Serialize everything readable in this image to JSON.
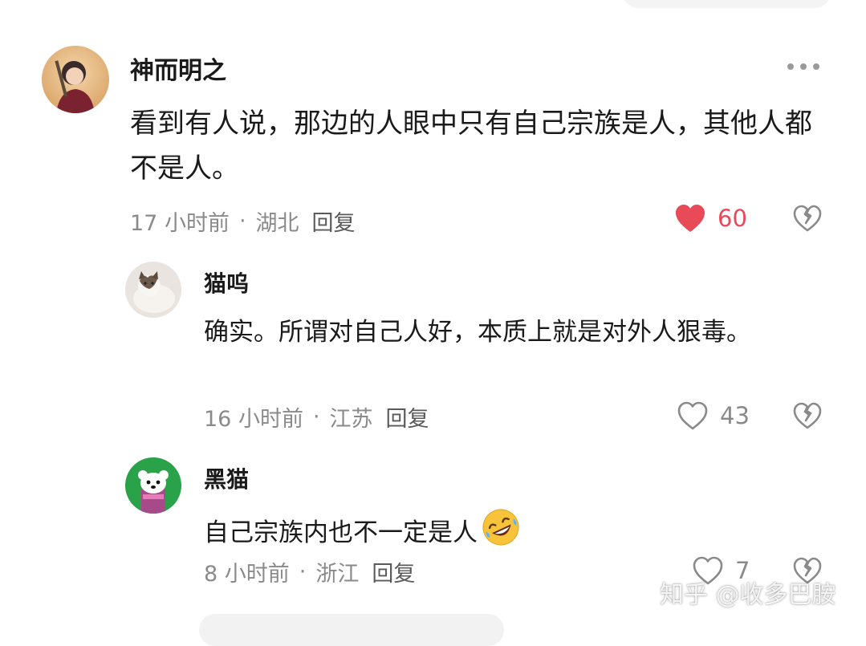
{
  "comments": [
    {
      "author": "神而明之",
      "text": "看到有人说，那边的人眼中只有自己宗族是人，其他人都不是人。",
      "time": "17 小时前",
      "separator": "·",
      "location": "湖北",
      "reply_label": "回复",
      "likes": "60",
      "liked": true
    },
    {
      "author": "猫呜",
      "text": "确实。所谓对自己人好，本质上就是对外人狠毒。",
      "time": "16 小时前",
      "separator": "·",
      "location": "江苏",
      "reply_label": "回复",
      "likes": "43",
      "liked": false
    },
    {
      "author": "黑猫",
      "text": "自己宗族内也不一定是人",
      "emoji": "rolling-on-floor-laughing",
      "time": "8 小时前",
      "separator": "·",
      "location": "浙江",
      "reply_label": "回复",
      "likes": "7",
      "liked": false
    }
  ],
  "watermark": "知乎 @收多巴胺",
  "colors": {
    "liked_heart": "#e84a57",
    "meta_text": "#8a8a8a",
    "reply_text": "#5a5a5a"
  }
}
